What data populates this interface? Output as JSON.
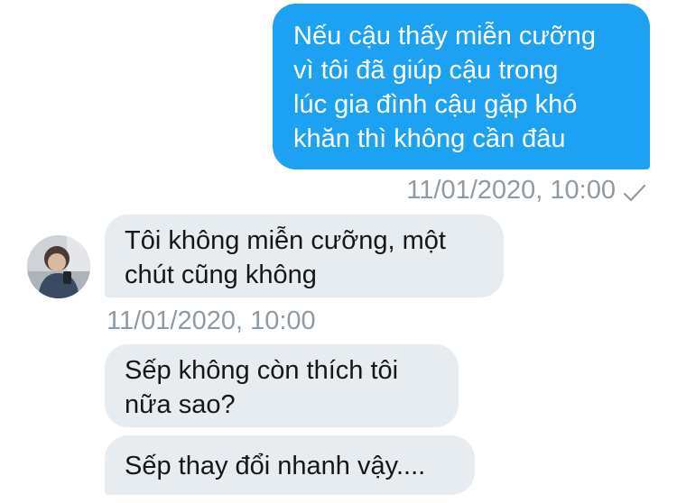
{
  "conversation": {
    "sent_message": {
      "text": "Nếu cậu thấy miễn cưỡng\nvì tôi đã giúp cậu trong\nlúc gia đình cậu gặp khó\nkhăn thì không cần đâu",
      "timestamp": "11/01/2020, 10:00",
      "status_icon": "check-icon"
    },
    "received_messages": [
      {
        "text": "Tôi không miễn cưỡng, một\nchút cũng không"
      },
      {
        "text": "Sếp không còn thích tôi\nnữa sao?"
      },
      {
        "text": "Sếp thay đổi nhanh vậy...."
      }
    ],
    "received_timestamp": "11/01/2020, 10:00",
    "avatar_icon": "user-avatar"
  },
  "colors": {
    "sent_bubble": "#1da1f2",
    "received_bubble": "#e6ecf0",
    "timestamp_text": "#8f9aa3",
    "received_text": "#14171a"
  }
}
